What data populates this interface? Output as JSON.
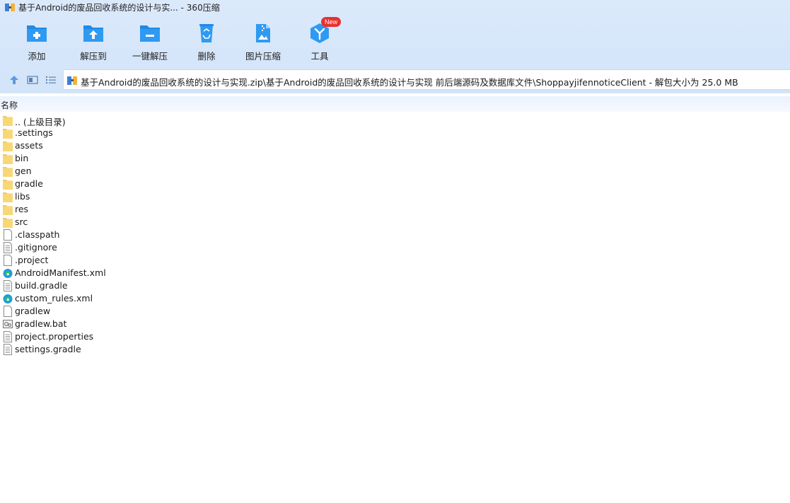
{
  "window": {
    "title": "基于Android的废品回收系统的设计与实... - 360压缩"
  },
  "toolbar": {
    "add_label": "添加",
    "extract_to_label": "解压到",
    "one_click_extract_label": "一键解压",
    "delete_label": "删除",
    "image_compress_label": "图片压缩",
    "tools_label": "工具",
    "tools_badge": "New"
  },
  "address": {
    "path": "基于Android的废品回收系统的设计与实现.zip\\基于Android的废品回收系统的设计与实现 前后端源码及数据库文件\\ShoppayjifennoticeClient - 解包大小为 25.0 MB"
  },
  "columns": {
    "name": "名称"
  },
  "files": [
    {
      "name": ".. (上级目录)",
      "icon": "folder-icon"
    },
    {
      "name": ".settings",
      "icon": "folder-icon"
    },
    {
      "name": "assets",
      "icon": "folder-icon"
    },
    {
      "name": "bin",
      "icon": "folder-icon"
    },
    {
      "name": "gen",
      "icon": "folder-icon"
    },
    {
      "name": "gradle",
      "icon": "folder-icon"
    },
    {
      "name": "libs",
      "icon": "folder-icon"
    },
    {
      "name": "res",
      "icon": "folder-icon"
    },
    {
      "name": "src",
      "icon": "folder-icon"
    },
    {
      "name": ".classpath",
      "icon": "blank-file-icon"
    },
    {
      "name": ".gitignore",
      "icon": "text-file-icon"
    },
    {
      "name": ".project",
      "icon": "blank-file-icon"
    },
    {
      "name": "AndroidManifest.xml",
      "icon": "edge-xml-icon"
    },
    {
      "name": "build.gradle",
      "icon": "text-file-icon"
    },
    {
      "name": "custom_rules.xml",
      "icon": "edge-xml-icon"
    },
    {
      "name": "gradlew",
      "icon": "blank-file-icon"
    },
    {
      "name": "gradlew.bat",
      "icon": "bat-file-icon"
    },
    {
      "name": "project.properties",
      "icon": "text-file-icon"
    },
    {
      "name": "settings.gradle",
      "icon": "text-file-icon"
    }
  ],
  "colors": {
    "accent": "#1e8ae6",
    "folder": "#f8d775",
    "badge": "#e8312f"
  }
}
